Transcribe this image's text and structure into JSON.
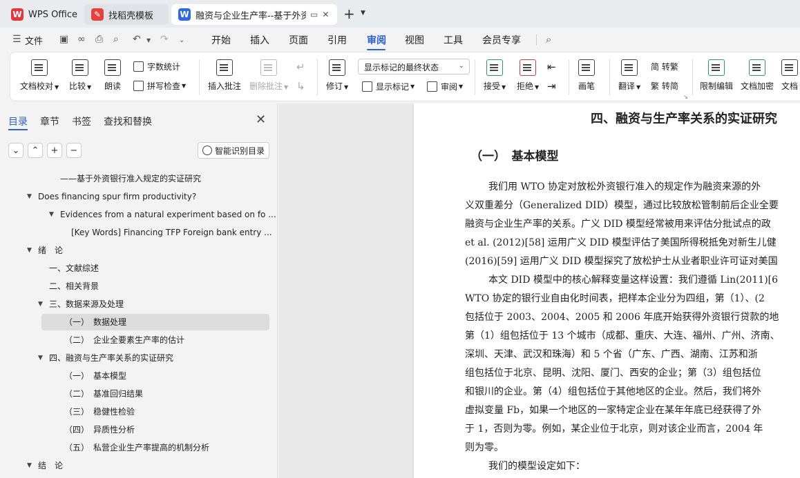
{
  "tabs": [
    {
      "label": "WPS Office"
    },
    {
      "label": "找稻壳模板"
    },
    {
      "label": "融资与企业生产率--基于外资银"
    }
  ],
  "menu": {
    "file": "文件",
    "items": [
      "开始",
      "插入",
      "页面",
      "引用",
      "审阅",
      "视图",
      "工具",
      "会员专享"
    ]
  },
  "ribbon": {
    "doc_check": "文档校对",
    "compare": "比较",
    "read_aloud": "朗读",
    "word_count": "字数统计",
    "spell_check": "拼写检查",
    "insert_comment": "插入批注",
    "delete_comment": "删除批注",
    "revise": "修订",
    "markup_select": "显示标记的最终状态",
    "show_markup": "显示标记",
    "review_pane": "审阅",
    "accept": "接受",
    "reject": "拒绝",
    "pen": "画笔",
    "translate": "翻译",
    "trad": "简 转繁",
    "simp": "繁 转简",
    "restrict_edit": "限制编辑",
    "encrypt": "文档加密",
    "doc_more": "文档"
  },
  "nav": {
    "tabs": [
      "目录",
      "章节",
      "书签",
      "查找和替换"
    ],
    "smart_toc": "智能识别目录",
    "toc": [
      "——基于外资银行准入规定的实证研究",
      "Does financing spur firm productivity?",
      "Evidences from a natural experiment based on fo ...",
      "[Key Words] Financing TFP Foreign bank entry ...",
      "绪　论",
      "一、文献综述",
      "二、相关背景",
      "三、数据来源及处理",
      "（一）　数据处理",
      "（二）　企业全要素生产率的估计",
      "四、融资与生产率关系的实证研究",
      "（一）　基本模型",
      "（二）　基准回归结果",
      "（三）　稳健性检验",
      "（四）　异质性分析",
      "（五）　私营企业生产率提高的机制分析",
      "结　论"
    ]
  },
  "doc": {
    "heading": "四、融资与生产率关系的实证研究",
    "subheading": "（一）　基本模型",
    "lines": [
      "我们用  WTO  协定对放松外资银行准入的规定作为融资来源的外",
      "义双重差分（Generalized DID）模型，通过比较放松管制前后企业全要",
      "融资与企业生产率的关系。广义  DID 模型经常被用来评估分批试点的政",
      "et al. (2012)[58]  运用广义  DID  模型评估了美国所得税抵免对新生儿健",
      "(2016)[59] 运用广义  DID  模型探究了放松护士从业者职业许可证对美国",
      "本文  DID 模型中的核心解释变量这样设置：我们遵循  Lin(2011)[6",
      "WTO 协定的银行业自由化时间表，把样本企业分为四组，第（1）、(2",
      "包括位于  2003、2004、2005 和 2006 年底开始获得外资银行贷款的地",
      "第（1）组包括位于  13 个城市（成都、重庆、大连、福州、广州、济南、",
      "深圳、天津、武汉和珠海）和 5 个省（广东、广西、湖南、江苏和浙",
      "组包括位于北京、昆明、沈阳、厦门、西安的企业；第（3）组包括位",
      "和银川的企业。第（4）组包括位于其他地区的企业。然后，我们将外",
      "虚拟变量  Fb，如果一个地区的一家特定企业在某年年底已经获得了外",
      "于 1，否则为零。例如，某企业位于北京，则对该企业而言，2004 年",
      "则为零。",
      "我们的模型设定如下："
    ]
  },
  "colors": {
    "accent": "#2c5fd8",
    "wps_red": "#e5373a",
    "word_blue": "#2d6ae2"
  }
}
